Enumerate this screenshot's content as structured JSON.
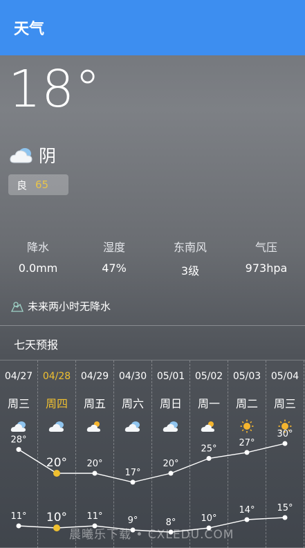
{
  "header": {
    "title": "天气"
  },
  "current": {
    "temperature": "18°",
    "condition": "阴",
    "condition_icon": "cloudy-icon",
    "aqi_label": "良",
    "aqi_value": "65"
  },
  "stats": [
    {
      "name": "降水",
      "value": "0.0mm"
    },
    {
      "name": "湿度",
      "value": "47%"
    },
    {
      "name": "东南风",
      "value": "3级"
    },
    {
      "name": "气压",
      "value": "973hpa"
    }
  ],
  "rain_forecast": "未来两小时无降水",
  "section_title": "七天预报",
  "days": [
    {
      "date": "04/27",
      "weekday": "周三",
      "icon": "cloudy-icon",
      "high": "28°",
      "low": "11°"
    },
    {
      "date": "04/28",
      "weekday": "周四",
      "icon": "cloudy-icon",
      "high": "20°",
      "low": "10°",
      "selected": true
    },
    {
      "date": "04/29",
      "weekday": "周五",
      "icon": "partly-sunny-icon",
      "high": "20°",
      "low": "11°"
    },
    {
      "date": "04/30",
      "weekday": "周六",
      "icon": "cloudy-icon",
      "high": "17°",
      "low": "9°"
    },
    {
      "date": "05/01",
      "weekday": "周日",
      "icon": "cloudy-icon",
      "high": "20°",
      "low": "8°"
    },
    {
      "date": "05/02",
      "weekday": "周一",
      "icon": "partly-sunny-icon",
      "high": "25°",
      "low": "10°"
    },
    {
      "date": "05/03",
      "weekday": "周二",
      "icon": "sunny-icon",
      "high": "27°",
      "low": "14°"
    },
    {
      "date": "05/04",
      "weekday": "周三",
      "icon": "sunny-icon",
      "high": "30°",
      "low": "15°"
    }
  ],
  "chart_data": {
    "type": "line",
    "x": [
      "04/27",
      "04/28",
      "04/29",
      "04/30",
      "05/01",
      "05/02",
      "05/03",
      "05/04"
    ],
    "series": [
      {
        "values": [
          28,
          20,
          20,
          17,
          20,
          25,
          27,
          30
        ]
      },
      {
        "values": [
          11,
          10,
          11,
          9,
          8,
          10,
          14,
          15
        ]
      }
    ]
  },
  "watermark": "晨曦乐下载 • CXLEDU.COM",
  "colors": {
    "appbar": "#3d8ef0",
    "selected": "#f0c030",
    "aqi_value": "#e8c44a"
  }
}
